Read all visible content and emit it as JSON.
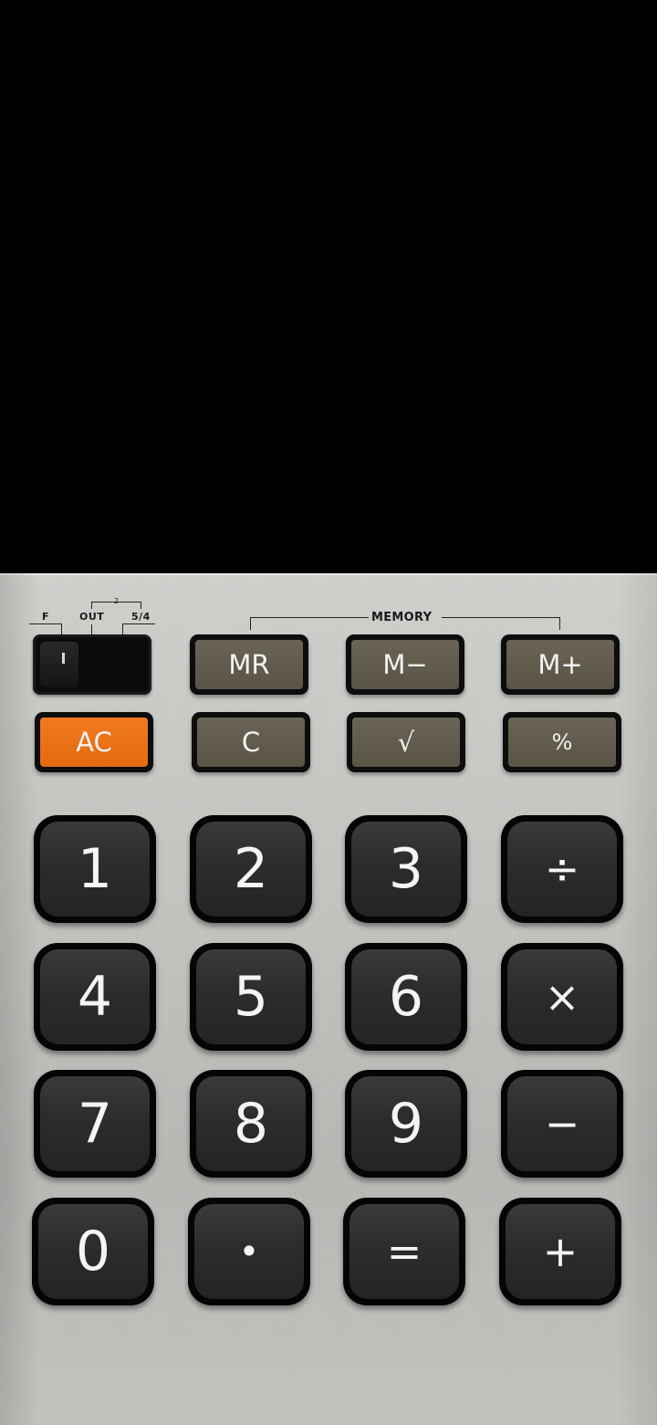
{
  "switch": {
    "labels": [
      "F",
      "OUT",
      "5/4"
    ],
    "small_mark": "2"
  },
  "memory": {
    "label": "MEMORY"
  },
  "function_keys": [
    {
      "label": "MR"
    },
    {
      "label": "M−"
    },
    {
      "label": "M+"
    },
    {
      "label": "AC"
    },
    {
      "label": "C"
    },
    {
      "label": "√"
    },
    {
      "label": "%"
    }
  ],
  "keypad": [
    {
      "label": "1"
    },
    {
      "label": "2"
    },
    {
      "label": "3"
    },
    {
      "label": "÷"
    },
    {
      "label": "4"
    },
    {
      "label": "5"
    },
    {
      "label": "6"
    },
    {
      "label": "×"
    },
    {
      "label": "7"
    },
    {
      "label": "8"
    },
    {
      "label": "9"
    },
    {
      "label": "−"
    },
    {
      "label": "0"
    },
    {
      "label": "•"
    },
    {
      "label": "="
    },
    {
      "label": "+"
    }
  ],
  "colors": {
    "ac_key": "#f07a1f",
    "function_key": "#5f5a4c",
    "number_key": "#2e2e2e",
    "display": "#000000"
  }
}
